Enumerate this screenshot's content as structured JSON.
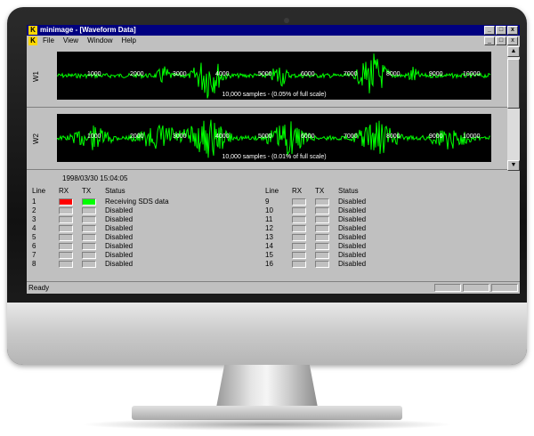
{
  "window": {
    "title": "minimage - [Waveform Data]",
    "controls": [
      "_",
      "□",
      "x"
    ],
    "child_controls": [
      "_",
      "□",
      "x"
    ]
  },
  "menu": [
    "File",
    "View",
    "Window",
    "Help"
  ],
  "plots": [
    {
      "channel": "W1",
      "ticks": [
        "1000",
        "2000",
        "3000",
        "4000",
        "5000",
        "6000",
        "7000",
        "8000",
        "9000",
        "10000"
      ],
      "samples_text": "10,000 samples - (0.05% of full scale)",
      "wave_color": "#00ff00"
    },
    {
      "channel": "W2",
      "ticks": [
        "1000",
        "2000",
        "3000",
        "4000",
        "5000",
        "6000",
        "7000",
        "8000",
        "9000",
        "10000"
      ],
      "samples_text": "10,000 samples - (0.01% of full scale)",
      "wave_color": "#00ff00"
    }
  ],
  "timestamp": "1998/03/30 15:04:05",
  "headers": {
    "line": "Line",
    "rx": "RX",
    "tx": "TX",
    "status": "Status"
  },
  "lines_left": [
    {
      "line": "1",
      "rx": "red",
      "tx": "green",
      "status": "Receiving SDS data"
    },
    {
      "line": "2",
      "rx": "off",
      "tx": "off",
      "status": "Disabled"
    },
    {
      "line": "3",
      "rx": "off",
      "tx": "off",
      "status": "Disabled"
    },
    {
      "line": "4",
      "rx": "off",
      "tx": "off",
      "status": "Disabled"
    },
    {
      "line": "5",
      "rx": "off",
      "tx": "off",
      "status": "Disabled"
    },
    {
      "line": "6",
      "rx": "off",
      "tx": "off",
      "status": "Disabled"
    },
    {
      "line": "7",
      "rx": "off",
      "tx": "off",
      "status": "Disabled"
    },
    {
      "line": "8",
      "rx": "off",
      "tx": "off",
      "status": "Disabled"
    }
  ],
  "lines_right": [
    {
      "line": "9",
      "rx": "off",
      "tx": "off",
      "status": "Disabled"
    },
    {
      "line": "10",
      "rx": "off",
      "tx": "off",
      "status": "Disabled"
    },
    {
      "line": "11",
      "rx": "off",
      "tx": "off",
      "status": "Disabled"
    },
    {
      "line": "12",
      "rx": "off",
      "tx": "off",
      "status": "Disabled"
    },
    {
      "line": "13",
      "rx": "off",
      "tx": "off",
      "status": "Disabled"
    },
    {
      "line": "14",
      "rx": "off",
      "tx": "off",
      "status": "Disabled"
    },
    {
      "line": "15",
      "rx": "off",
      "tx": "off",
      "status": "Disabled"
    },
    {
      "line": "16",
      "rx": "off",
      "tx": "off",
      "status": "Disabled"
    }
  ],
  "led_colors": {
    "red": "#ff0000",
    "green": "#00ff00",
    "off": "#c0c0c0"
  },
  "statusbar": {
    "text": "Ready"
  }
}
